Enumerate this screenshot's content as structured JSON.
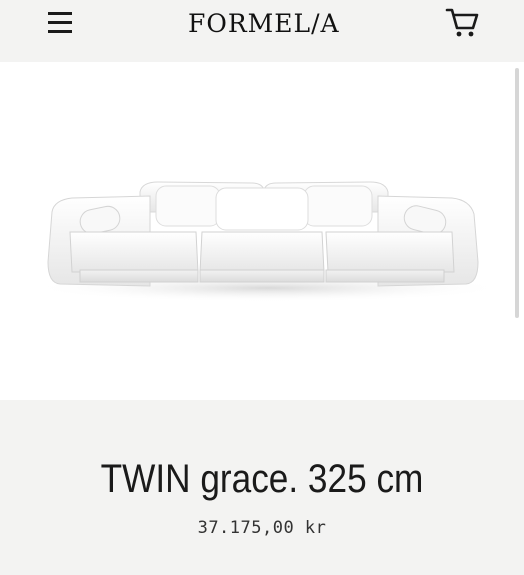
{
  "header": {
    "logo_text": "FORMEL/A",
    "menu_icon": "hamburger-menu-icon",
    "cart_icon": "shopping-cart-icon"
  },
  "product": {
    "image_subject": "sofa-image",
    "title": "TWIN grace. 325 cm",
    "price": "37.175,00 kr"
  },
  "colors": {
    "background": "#f3f3f2",
    "image_background": "#ffffff",
    "text": "#1a1a1a"
  }
}
